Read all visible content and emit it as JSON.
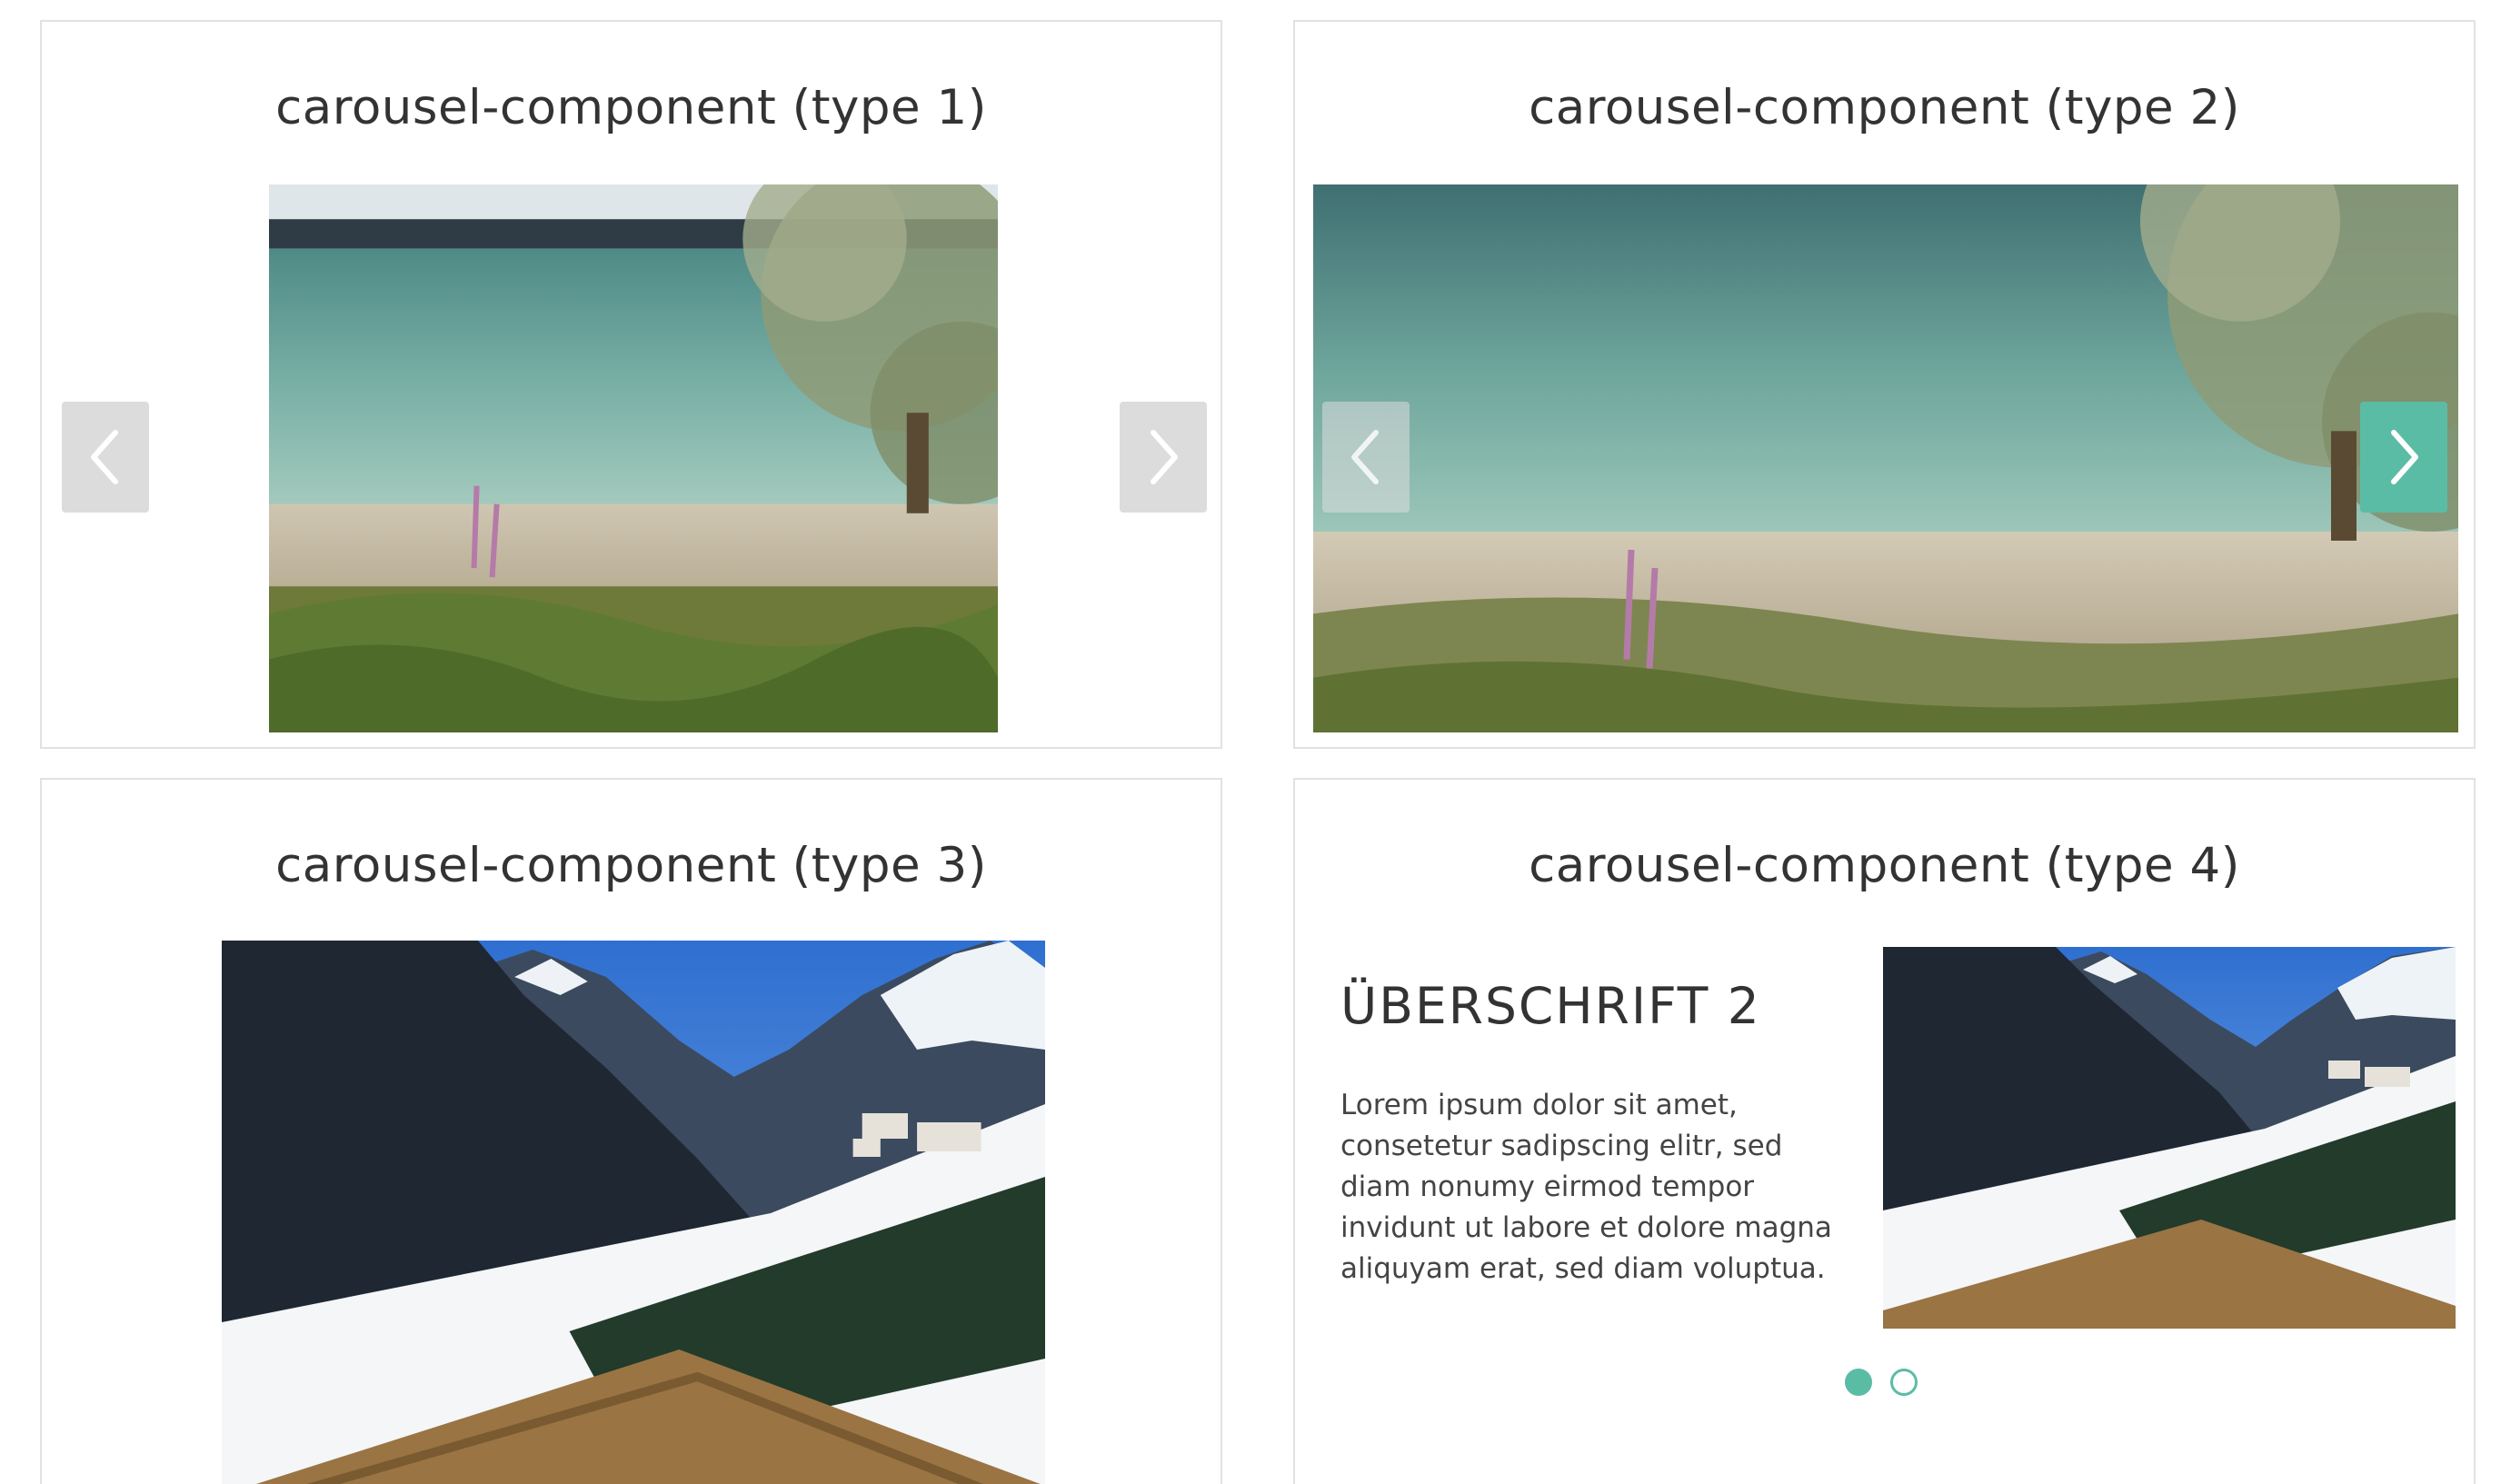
{
  "colors": {
    "accent": "#5bbca6",
    "nav_grey": "#dcdcdc",
    "border": "#e2e2e2",
    "text": "#333333"
  },
  "cards": [
    {
      "title": "carousel-component (type 1)",
      "image": "lake-shore-photo",
      "prev_icon": "chevron-left-icon",
      "next_icon": "chevron-right-icon"
    },
    {
      "title": "carousel-component (type 2)",
      "image": "lake-shore-photo",
      "prev_icon": "chevron-left-icon",
      "next_icon": "chevron-right-icon"
    },
    {
      "title": "carousel-component (type 3)",
      "image": "snowy-mountain-valley-photo"
    },
    {
      "title": "carousel-component (type 4)",
      "image": "snowy-mountain-valley-photo",
      "heading": "ÜBERSCHRIFT 2",
      "text": "Lorem ipsum dolor sit amet, consetetur sadipscing elitr, sed diam nonumy eirmod tempor invidunt ut labore et dolore magna aliquyam erat, sed diam voluptua.",
      "dots_total": 2,
      "dots_active": 1
    }
  ]
}
